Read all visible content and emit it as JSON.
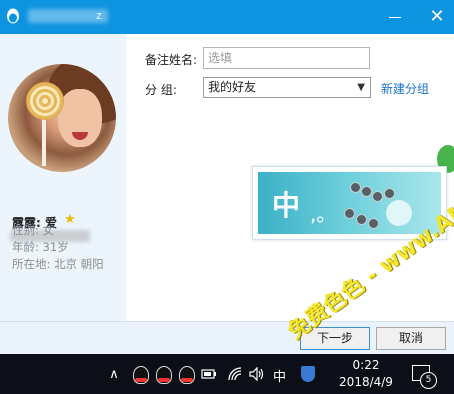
{
  "titlebar": {
    "title_fragment": "z",
    "close_glyph": "✕"
  },
  "profile": {
    "nickname": "露露: 爱",
    "gender": "性别: 女",
    "age": "年龄: 31岁",
    "location": "所在地: 北京  朝阳"
  },
  "form": {
    "remark_label": "备注姓名:",
    "remark_placeholder": "选填",
    "group_label": "分   组:",
    "group_value": "我的好友",
    "new_group_link": "新建分组"
  },
  "ad": {
    "text_main": "中",
    "text_dot": ",。"
  },
  "buttons": {
    "next": "下一步",
    "cancel": "取消"
  },
  "taskbar": {
    "ime_label": "中",
    "time": "0:22",
    "date": "2018/4/9",
    "notification_count": "5"
  },
  "watermark": {
    "text": "免费色色 - www.AMFsese.com"
  },
  "colors": {
    "titlebar": "#0d94e0",
    "link": "#1a73c9",
    "taskbar": "#0c0f18",
    "star": "#f2b705"
  }
}
